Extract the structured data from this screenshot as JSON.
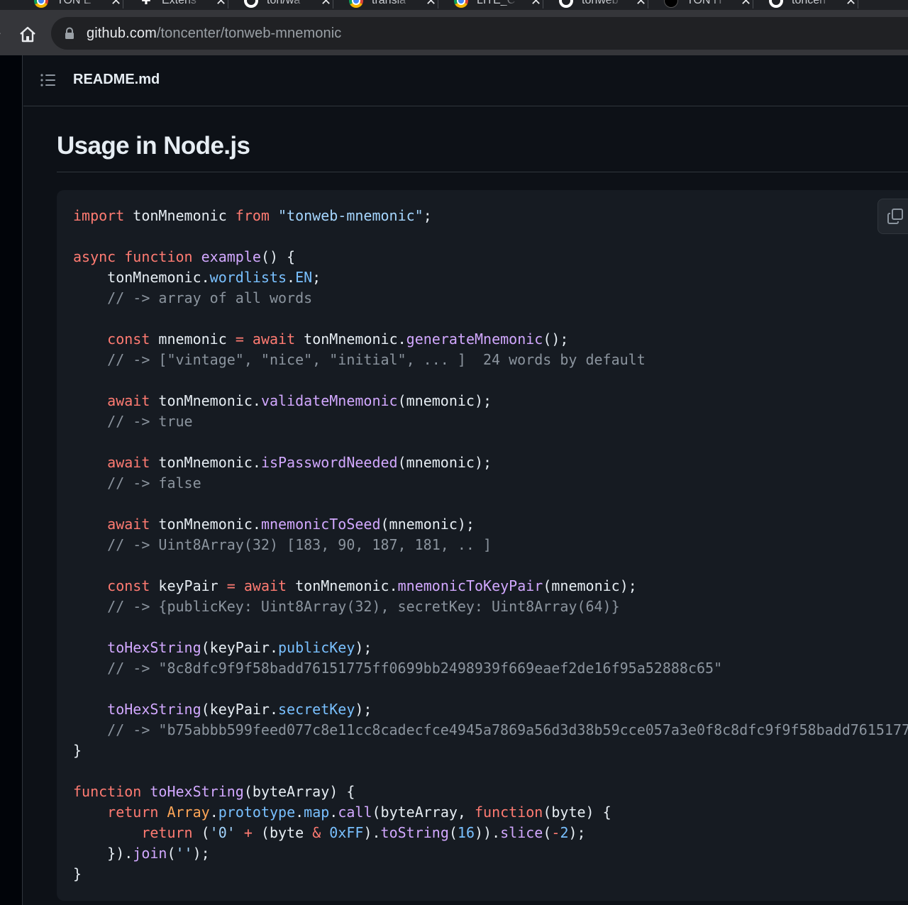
{
  "browser": {
    "tabs": [
      {
        "title": "TON E",
        "favicon": "chrome-icon"
      },
      {
        "title": "Extens",
        "favicon": "puzzle-icon"
      },
      {
        "title": "ton/wa",
        "favicon": "github-icon"
      },
      {
        "title": "transla",
        "favicon": "chrome-icon"
      },
      {
        "title": "LITE_C",
        "favicon": "chrome-icon"
      },
      {
        "title": "tonweb",
        "favicon": "github-icon"
      },
      {
        "title": "TON H",
        "favicon": "dark-circle-icon"
      },
      {
        "title": "toncen",
        "favicon": "github-icon"
      }
    ],
    "url_domain": "github.com",
    "url_path": "/toncenter/tonweb-mnemonic"
  },
  "readme": {
    "filename": "README.md",
    "heading": "Usage in Node.js"
  },
  "colors": {
    "keyword": "#ff7b72",
    "string": "#a5d6ff",
    "function": "#d2a8ff",
    "property": "#79c0ff",
    "comment": "#8b949e",
    "class": "#ffa657",
    "text": "#e6edf3"
  },
  "code_lines": [
    [
      [
        "kw",
        "import"
      ],
      [
        "plain",
        " tonMnemonic "
      ],
      [
        "kw",
        "from"
      ],
      [
        "plain",
        " "
      ],
      [
        "str",
        "\"tonweb-mnemonic\""
      ],
      [
        "plain",
        ";"
      ]
    ],
    [],
    [
      [
        "kw",
        "async"
      ],
      [
        "plain",
        " "
      ],
      [
        "kw",
        "function"
      ],
      [
        "plain",
        " "
      ],
      [
        "fn",
        "example"
      ],
      [
        "plain",
        "() {"
      ]
    ],
    [
      [
        "plain",
        "    tonMnemonic."
      ],
      [
        "prop",
        "wordlists"
      ],
      [
        "plain",
        "."
      ],
      [
        "prop",
        "EN"
      ],
      [
        "plain",
        ";"
      ]
    ],
    [
      [
        "cmt",
        "    // -> array of all words"
      ]
    ],
    [],
    [
      [
        "plain",
        "    "
      ],
      [
        "kw",
        "const"
      ],
      [
        "plain",
        " mnemonic "
      ],
      [
        "op",
        "="
      ],
      [
        "plain",
        " "
      ],
      [
        "kw",
        "await"
      ],
      [
        "plain",
        " tonMnemonic."
      ],
      [
        "fn",
        "generateMnemonic"
      ],
      [
        "plain",
        "();"
      ]
    ],
    [
      [
        "cmt",
        "    // -> [\"vintage\", \"nice\", \"initial\", ... ]  24 words by default"
      ]
    ],
    [],
    [
      [
        "plain",
        "    "
      ],
      [
        "kw",
        "await"
      ],
      [
        "plain",
        " tonMnemonic."
      ],
      [
        "fn",
        "validateMnemonic"
      ],
      [
        "plain",
        "(mnemonic);"
      ]
    ],
    [
      [
        "cmt",
        "    // -> true"
      ]
    ],
    [],
    [
      [
        "plain",
        "    "
      ],
      [
        "kw",
        "await"
      ],
      [
        "plain",
        " tonMnemonic."
      ],
      [
        "fn",
        "isPasswordNeeded"
      ],
      [
        "plain",
        "(mnemonic);"
      ]
    ],
    [
      [
        "cmt",
        "    // -> false"
      ]
    ],
    [],
    [
      [
        "plain",
        "    "
      ],
      [
        "kw",
        "await"
      ],
      [
        "plain",
        " tonMnemonic."
      ],
      [
        "fn",
        "mnemonicToSeed"
      ],
      [
        "plain",
        "(mnemonic);"
      ]
    ],
    [
      [
        "cmt",
        "    // -> Uint8Array(32) [183, 90, 187, 181, .. ]"
      ]
    ],
    [],
    [
      [
        "plain",
        "    "
      ],
      [
        "kw",
        "const"
      ],
      [
        "plain",
        " keyPair "
      ],
      [
        "op",
        "="
      ],
      [
        "plain",
        " "
      ],
      [
        "kw",
        "await"
      ],
      [
        "plain",
        " tonMnemonic."
      ],
      [
        "fn",
        "mnemonicToKeyPair"
      ],
      [
        "plain",
        "(mnemonic);"
      ]
    ],
    [
      [
        "cmt",
        "    // -> {publicKey: Uint8Array(32), secretKey: Uint8Array(64)}"
      ]
    ],
    [],
    [
      [
        "plain",
        "    "
      ],
      [
        "fn",
        "toHexString"
      ],
      [
        "plain",
        "(keyPair."
      ],
      [
        "prop",
        "publicKey"
      ],
      [
        "plain",
        ");"
      ]
    ],
    [
      [
        "cmt",
        "    // -> \"8c8dfc9f9f58badd76151775ff0699bb2498939f669eaef2de16f95a52888c65\""
      ]
    ],
    [],
    [
      [
        "plain",
        "    "
      ],
      [
        "fn",
        "toHexString"
      ],
      [
        "plain",
        "(keyPair."
      ],
      [
        "prop",
        "secretKey"
      ],
      [
        "plain",
        ");"
      ]
    ],
    [
      [
        "cmt",
        "    // -> \"b75abbb599feed077c8e11cc8cadecfce4945a7869a56d3d38b59cce057a3e0f8c8dfc9f9f58badd7615177"
      ]
    ],
    [
      [
        "plain",
        "}"
      ]
    ],
    [],
    [
      [
        "kw",
        "function"
      ],
      [
        "plain",
        " "
      ],
      [
        "fn",
        "toHexString"
      ],
      [
        "plain",
        "(byteArray) {"
      ]
    ],
    [
      [
        "plain",
        "    "
      ],
      [
        "kw",
        "return"
      ],
      [
        "plain",
        " "
      ],
      [
        "cls",
        "Array"
      ],
      [
        "plain",
        "."
      ],
      [
        "prop",
        "prototype"
      ],
      [
        "plain",
        "."
      ],
      [
        "prop",
        "map"
      ],
      [
        "plain",
        "."
      ],
      [
        "fn",
        "call"
      ],
      [
        "plain",
        "(byteArray, "
      ],
      [
        "kw",
        "function"
      ],
      [
        "plain",
        "(byte) {"
      ]
    ],
    [
      [
        "plain",
        "        "
      ],
      [
        "kw",
        "return"
      ],
      [
        "plain",
        " ("
      ],
      [
        "str",
        "'0'"
      ],
      [
        "plain",
        " "
      ],
      [
        "op",
        "+"
      ],
      [
        "plain",
        " (byte "
      ],
      [
        "op",
        "&"
      ],
      [
        "plain",
        " "
      ],
      [
        "num",
        "0xFF"
      ],
      [
        "plain",
        ")."
      ],
      [
        "fn",
        "toString"
      ],
      [
        "plain",
        "("
      ],
      [
        "num",
        "16"
      ],
      [
        "plain",
        "))."
      ],
      [
        "fn",
        "slice"
      ],
      [
        "plain",
        "("
      ],
      [
        "op",
        "-"
      ],
      [
        "num",
        "2"
      ],
      [
        "plain",
        ");"
      ]
    ],
    [
      [
        "plain",
        "    })."
      ],
      [
        "fn",
        "join"
      ],
      [
        "plain",
        "("
      ],
      [
        "str",
        "''"
      ],
      [
        "plain",
        ");"
      ]
    ],
    [
      [
        "plain",
        "}"
      ]
    ]
  ]
}
